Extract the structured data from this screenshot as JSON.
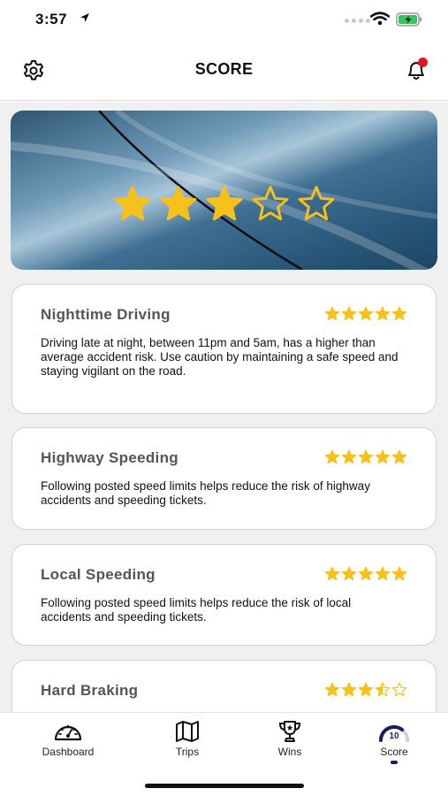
{
  "status_bar": {
    "time": "3:57"
  },
  "header": {
    "title": "SCORE"
  },
  "hero": {
    "rating": 3,
    "max": 5
  },
  "cards": [
    {
      "title": "Nighttime Driving",
      "rating": 5,
      "description": "Driving late at night, between 11pm and 5am, has a higher than average accident risk.  Use caution by maintaining a safe speed and staying vigilant on the road."
    },
    {
      "title": "Highway Speeding",
      "rating": 5,
      "description": "Following posted speed limits helps reduce the risk of highway accidents and speeding tickets."
    },
    {
      "title": "Local Speeding",
      "rating": 5,
      "description": "Following posted speed limits helps reduce the risk of local accidents and speeding tickets."
    },
    {
      "title": "Hard Braking",
      "rating": 3.5,
      "description": ""
    }
  ],
  "tabs": [
    {
      "label": "Dashboard",
      "icon": "speedometer-icon"
    },
    {
      "label": "Trips",
      "icon": "map-icon"
    },
    {
      "label": "Wins",
      "icon": "trophy-icon"
    },
    {
      "label": "Score",
      "icon": "score-gauge-icon",
      "badge": "10",
      "active": true
    }
  ],
  "colors": {
    "star": "#f5c11a",
    "accent": "#1c1a63",
    "notification": "#e8121f"
  }
}
